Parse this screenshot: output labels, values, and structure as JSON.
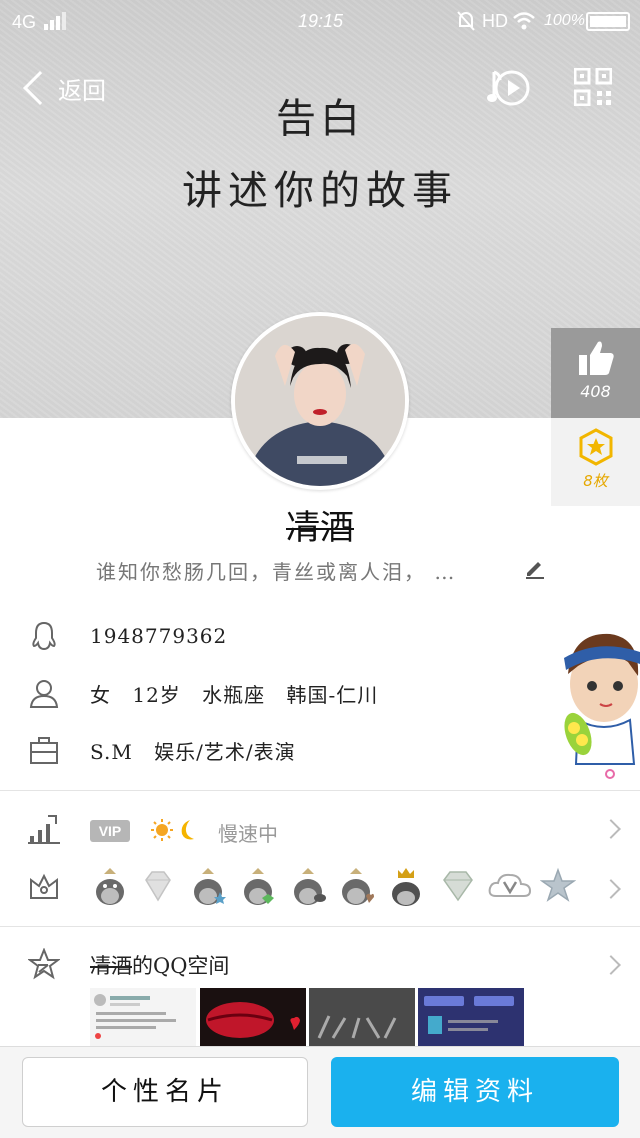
{
  "status_bar": {
    "network": "4G",
    "time": "19:15",
    "hd": "HD",
    "battery": "100%"
  },
  "nav": {
    "back_label": "返回"
  },
  "hero": {
    "title": "告白",
    "subtitle": "讲述你的故事"
  },
  "likes": {
    "count": "408"
  },
  "medals": {
    "count": "8枚"
  },
  "profile": {
    "nickname": "凊酒",
    "signature": "谁知你愁肠几回，青丝或离人泪，  …"
  },
  "info": {
    "qq_number": "1948779362",
    "personal": "女 12岁 水瓶座 韩国-仁川",
    "job": "S.M 娱乐/艺术/表演"
  },
  "vip": {
    "badge": "VIP",
    "status": "慢速中"
  },
  "space": {
    "owner": "凊酒",
    "title_suffix": "的QQ空间"
  },
  "buttons": {
    "card": "个性名片",
    "edit": "编辑资料"
  },
  "colors": {
    "accent": "#1ab1ee",
    "medal": "#f2b600",
    "like_bg": "#9a9a9a"
  }
}
